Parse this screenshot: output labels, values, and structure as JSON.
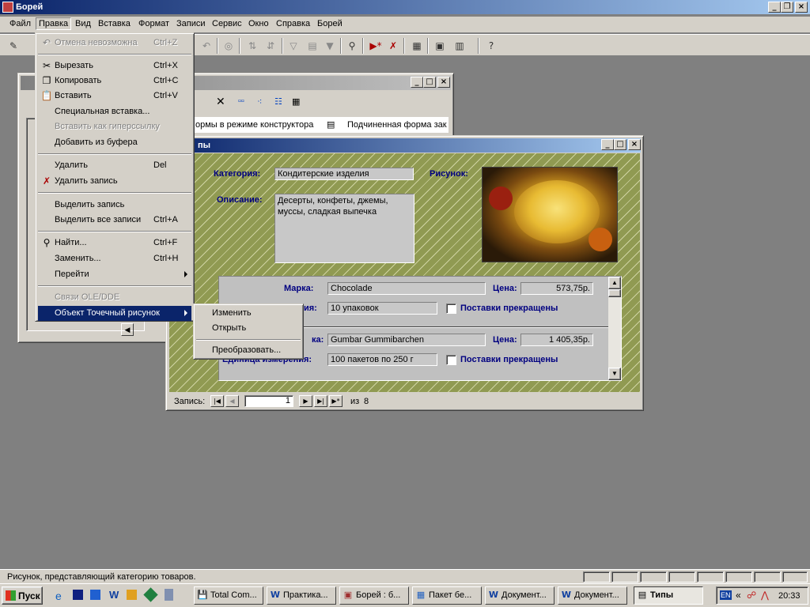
{
  "app": {
    "title": "Борей"
  },
  "menu": [
    "Файл",
    "Правка",
    "Вид",
    "Вставка",
    "Формат",
    "Записи",
    "Сервис",
    "Окно",
    "Справка",
    "Борей"
  ],
  "edit_menu": {
    "undo": {
      "label": "Отмена невозможна",
      "key": "Ctrl+Z"
    },
    "cut": {
      "label": "Вырезать",
      "key": "Ctrl+X"
    },
    "copy": {
      "label": "Копировать",
      "key": "Ctrl+C"
    },
    "paste": {
      "label": "Вставить",
      "key": "Ctrl+V"
    },
    "paste_special": {
      "label": "Специальная вставка..."
    },
    "paste_hyperlink": {
      "label": "Вставить как гиперссылку"
    },
    "paste_append": {
      "label": "Добавить из буфера"
    },
    "delete": {
      "label": "Удалить",
      "key": "Del"
    },
    "delete_record": {
      "label": "Удалить запись"
    },
    "select_record": {
      "label": "Выделить запись"
    },
    "select_all": {
      "label": "Выделить все записи",
      "key": "Ctrl+A"
    },
    "find": {
      "label": "Найти...",
      "key": "Ctrl+F"
    },
    "replace": {
      "label": "Заменить...",
      "key": "Ctrl+H"
    },
    "goto": {
      "label": "Перейти"
    },
    "ole_links": {
      "label": "Связи OLE/DDE"
    },
    "bitmap_object": {
      "label": "Объект Точечный рисунок"
    }
  },
  "sub_menu": {
    "edit": "Изменить",
    "open": "Открыть",
    "convert": "Преобразовать..."
  },
  "db_window": {
    "tab1": "ормы в режиме конструктора",
    "tab2": "Подчиненная форма зак"
  },
  "form": {
    "title_fragment": "пы",
    "category_label": "Категория:",
    "category_value": "Кондитерские изделия",
    "picture_label": "Рисунок:",
    "description_label": "Описание:",
    "description_value": "Десерты, конфеты, джемы, муссы, сладкая выпечка",
    "products": [
      {
        "brand_label": "Марка:",
        "brand": "Chocolade",
        "price_label": "Цена:",
        "price": "573,75р.",
        "unit_label": "ия:",
        "unit": "10 упаковок",
        "discontinued_label": "Поставки прекращены"
      },
      {
        "brand_label": "ка:",
        "brand": "Gumbar Gummibarchen",
        "price_label": "Цена:",
        "price": "1 405,35р.",
        "unit_label": "Единица измерения:",
        "unit": "100 пакетов по 250 г",
        "discontinued_label": "Поставки прекращены"
      }
    ],
    "nav": {
      "record_label": "Запись:",
      "current": "1",
      "of_label": "из",
      "total": "8"
    }
  },
  "status_text": "Рисунок, представляющий категорию товаров.",
  "taskbar": {
    "start": "Пуск",
    "tasks": [
      "Total Com...",
      "Практика...",
      "Борей : б...",
      "Пакет бе...",
      "Документ...",
      "Документ...",
      "Типы"
    ],
    "lang": "EN",
    "time": "20:33"
  }
}
